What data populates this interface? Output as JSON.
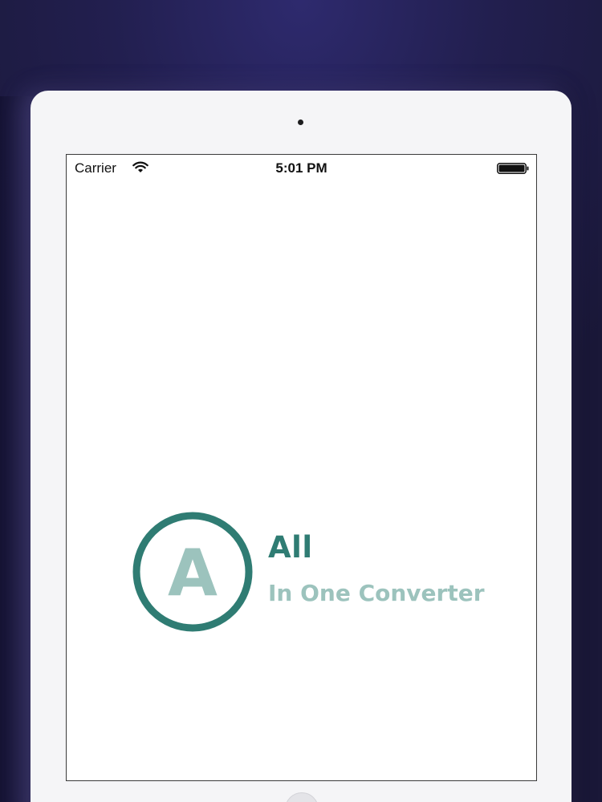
{
  "status_bar": {
    "carrier": "Carrier",
    "time": "5:01 PM",
    "wifi_icon": "wifi-icon",
    "battery_icon": "battery-full-icon"
  },
  "splash": {
    "logo_letter": "A",
    "title": "All",
    "subtitle": "In One Converter"
  },
  "colors": {
    "brand_dark": "#2f7c73",
    "brand_light": "#9cc3bd",
    "background": "#221f4f"
  }
}
